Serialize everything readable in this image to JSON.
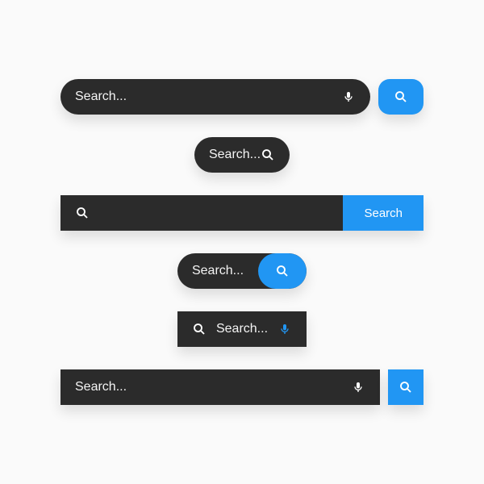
{
  "colors": {
    "dark": "#2b2b2b",
    "blue": "#2196f3",
    "white": "#ffffff"
  },
  "bars": {
    "bar1": {
      "placeholder": "Search..."
    },
    "bar2": {
      "placeholder": "Search..."
    },
    "bar3": {
      "button_label": "Search"
    },
    "bar4": {
      "placeholder": "Search..."
    },
    "bar5": {
      "placeholder": "Search..."
    },
    "bar6": {
      "placeholder": "Search..."
    }
  }
}
